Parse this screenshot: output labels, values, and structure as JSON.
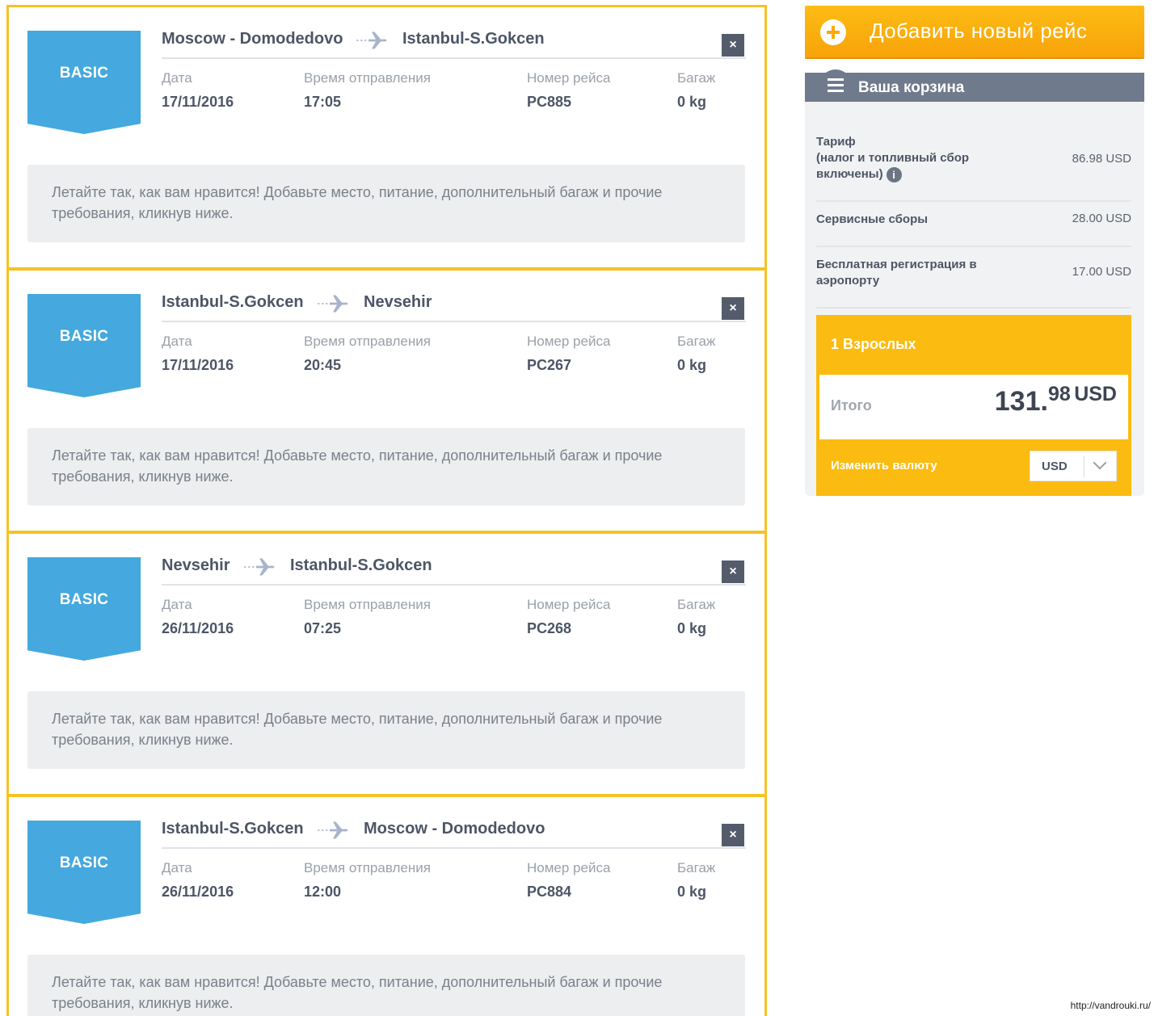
{
  "flights": [
    {
      "fare_tag": "BASIC",
      "from": "Moscow - Domodedovo",
      "to": "Istanbul-S.Gokcen",
      "date_label": "Дата",
      "date": "17/11/2016",
      "time_label": "Время отправления",
      "time": "17:05",
      "number_label": "Номер рейса",
      "number": "PC885",
      "baggage_label": "Багаж",
      "baggage": "0 kg",
      "note": "Летайте так, как вам нравится! Добавьте место, питание, дополнительный багаж и прочие требования, кликнув ниже."
    },
    {
      "fare_tag": "BASIC",
      "from": "Istanbul-S.Gokcen",
      "to": "Nevsehir",
      "date_label": "Дата",
      "date": "17/11/2016",
      "time_label": "Время отправления",
      "time": "20:45",
      "number_label": "Номер рейса",
      "number": "PC267",
      "baggage_label": "Багаж",
      "baggage": "0 kg",
      "note": "Летайте так, как вам нравится! Добавьте место, питание, дополнительный багаж и прочие требования, кликнув ниже."
    },
    {
      "fare_tag": "BASIC",
      "from": "Nevsehir",
      "to": "Istanbul-S.Gokcen",
      "date_label": "Дата",
      "date": "26/11/2016",
      "time_label": "Время отправления",
      "time": "07:25",
      "number_label": "Номер рейса",
      "number": "PC268",
      "baggage_label": "Багаж",
      "baggage": "0 kg",
      "note": "Летайте так, как вам нравится! Добавьте место, питание, дополнительный багаж и прочие требования, кликнув ниже."
    },
    {
      "fare_tag": "BASIC",
      "from": "Istanbul-S.Gokcen",
      "to": "Moscow - Domodedovo",
      "date_label": "Дата",
      "date": "26/11/2016",
      "time_label": "Время отправления",
      "time": "12:00",
      "number_label": "Номер рейса",
      "number": "PC884",
      "baggage_label": "Багаж",
      "baggage": "0 kg",
      "note": "Летайте так, как вам нравится! Добавьте место, питание, дополнительный багаж и прочие требования, кликнув ниже."
    }
  ],
  "close_glyph": "×",
  "add_flight": {
    "label": "Добавить новый рейс"
  },
  "cart": {
    "title": "Ваша корзина",
    "rows": [
      {
        "label": "Тариф\n(налог и топливный сбор\nвключены)",
        "value": "86.98 USD"
      },
      {
        "label": "Сервисные сборы",
        "value": "28.00 USD"
      },
      {
        "label": "Бесплатная регистрация в\nаэропорту",
        "value": "17.00 USD"
      }
    ],
    "passengers": "1 Взрослых",
    "total_label": "Итого",
    "total_whole": "131.",
    "total_cents": "98",
    "total_currency": "USD",
    "change_currency_label": "Изменить валюту",
    "currency_selected": "USD"
  },
  "colors": {
    "card_border": "#f7c224",
    "fare_tag": "#45a8de",
    "accent_orange": "#f8a30a",
    "cart_header": "#707a8d"
  },
  "watermark": "http://vandrouki.ru/"
}
